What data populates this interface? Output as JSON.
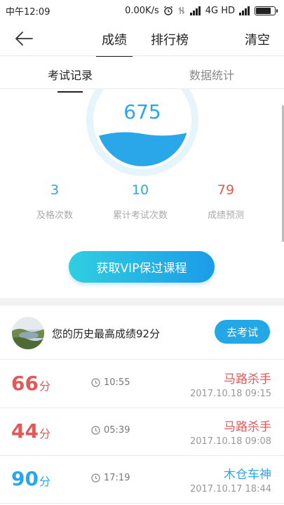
{
  "status_bar": {
    "time": "中午12:09",
    "speed": "0.00K/s",
    "network": "4G HD"
  },
  "nav": {
    "back_icon": "arrow-left-icon",
    "tabs": [
      "成绩",
      "排行榜"
    ],
    "clear_label": "清空"
  },
  "sub_tabs": [
    "考试记录",
    "数据统计"
  ],
  "gauge": {
    "score": "675",
    "fill_fraction": 0.35,
    "colors": {
      "ring": "#e6f4fc",
      "water": "#29a7e8"
    }
  },
  "stats": [
    {
      "value": "3",
      "label": "及格次数",
      "color": "#29a7e8"
    },
    {
      "value": "10",
      "label": "累计考试次数",
      "color": "#29a7e8"
    },
    {
      "value": "79",
      "label": "成绩预测",
      "color": "#e05a5a"
    }
  ],
  "vip_button_label": "获取VIP保过课程",
  "history": {
    "text": "您的历史最高成绩92分",
    "button_label": "去考试"
  },
  "records": [
    {
      "score": "66",
      "unit": "分",
      "duration": "10:55",
      "title": "马路杀手",
      "date": "2017.10.18  09:15",
      "status": "fail"
    },
    {
      "score": "44",
      "unit": "分",
      "duration": "05:39",
      "title": "马路杀手",
      "date": "2017.10.18  09:08",
      "status": "fail"
    },
    {
      "score": "90",
      "unit": "分",
      "duration": "17:19",
      "title": "木仓车神",
      "date": "2017.10.17  18:44",
      "status": "pass"
    }
  ]
}
